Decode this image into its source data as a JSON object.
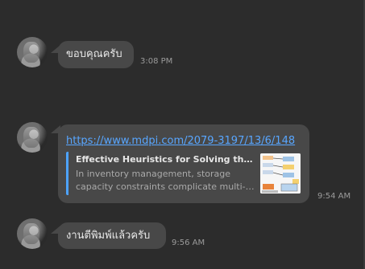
{
  "messages": [
    {
      "text": "ขอบคุณครับ",
      "time": "3:08 PM"
    },
    {
      "link": "https://www.mdpi.com/2079-3197/13/6/148",
      "preview": {
        "title": "Effective Heuristics for Solving the Multi...",
        "desc_line1": "In inventory management, storage",
        "desc_line2": "capacity constraints complicate multi-it..."
      },
      "thumbnail_icon": "article-diagram-thumbnail",
      "time": "9:54 AM"
    },
    {
      "text": "งานตีพิมพ์แล้วครับ",
      "time": "9:56 AM"
    }
  ],
  "colors": {
    "background": "#2c2c2c",
    "bubble": "#484848",
    "link": "#58a6ff",
    "preview_accent": "#4da3ff"
  }
}
